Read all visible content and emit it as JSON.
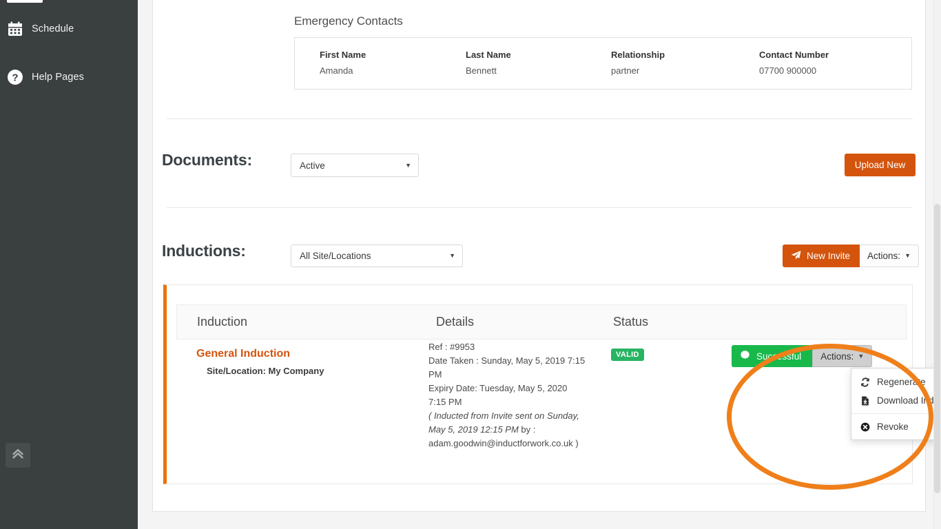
{
  "sidebar": {
    "items": [
      {
        "label": "Schedule",
        "icon": "calendar-icon"
      },
      {
        "label": "Help Pages",
        "icon": "question-circle-icon"
      }
    ],
    "collapse_icon": "double-chevron-up-icon"
  },
  "emergency_contacts": {
    "title": "Emergency Contacts",
    "columns": [
      "First Name",
      "Last Name",
      "Relationship",
      "Contact Number"
    ],
    "rows": [
      {
        "first_name": "Amanda",
        "last_name": "Bennett",
        "relationship": "partner",
        "contact_number": "07700 900000"
      }
    ]
  },
  "documents": {
    "title": "Documents:",
    "filter_value": "Active",
    "upload_label": "Upload New"
  },
  "inductions": {
    "title": "Inductions:",
    "filter_value": "All Site/Locations",
    "new_invite_label": "New Invite",
    "new_invite_icon": "paper-plane-icon",
    "actions_label": "Actions:",
    "table": {
      "columns": [
        "Induction",
        "Details",
        "Status"
      ],
      "rows": [
        {
          "name": "General Induction",
          "site_location": "Site/Location: My Company",
          "details": {
            "ref": "Ref : #9953",
            "date_taken": "Date Taken : Sunday, May 5, 2019 7:15 PM",
            "expiry_date": "Expiry Date: Tuesday, May 5, 2020 7:15 PM",
            "invite_note_italic": "( Inducted from Invite sent on Sunday, May 5, 2019 12:15 PM",
            "invite_note_tail": " by :",
            "invite_email": "adam.goodwin@inductforwork.co.uk )"
          },
          "status_badge": "VALID",
          "status_button": "Successful",
          "status_button_icon": "certificate-icon",
          "row_actions_label": "Actions:"
        }
      ]
    },
    "dropdown": {
      "items": [
        {
          "label": "Regenerate",
          "icon": "refresh-icon"
        },
        {
          "label": "Download Induction",
          "icon": "file-download-icon"
        },
        {
          "label": "Revoke",
          "icon": "times-circle-icon"
        }
      ]
    }
  },
  "colors": {
    "brand_orange": "#d4540d",
    "annotation_orange": "#ef7f1a",
    "success_green": "#19b84b",
    "badge_green": "#28b463",
    "sidebar_bg": "#3a3f3f"
  }
}
